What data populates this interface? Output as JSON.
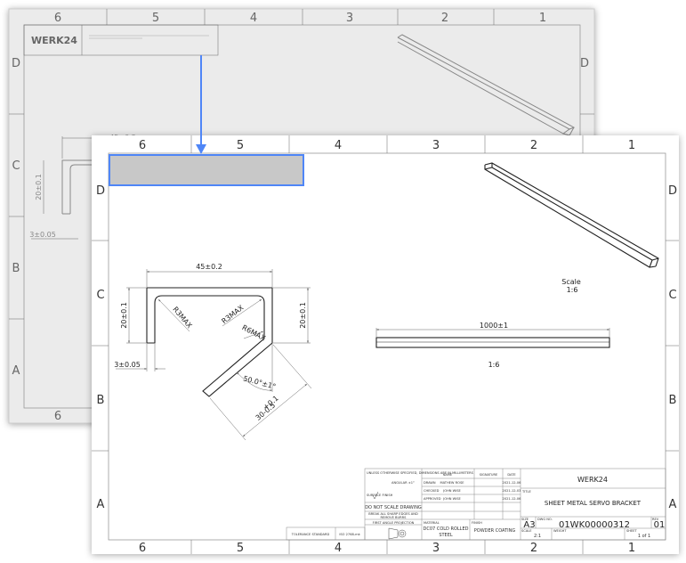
{
  "colors": {
    "accent": "#4f86f7",
    "highlight_fill": "#c8c8c8",
    "back_sheet": "#ebebeb"
  },
  "back_sheet": {
    "logo": "WERK24",
    "columns": [
      "6",
      "5",
      "4",
      "3",
      "2",
      "1"
    ],
    "rows": [
      "D",
      "C",
      "B",
      "A"
    ],
    "dims": {
      "width": "45±0.2",
      "height": "20±0.1",
      "thickness": "3±0.05"
    }
  },
  "sheet": {
    "columns": [
      "6",
      "5",
      "4",
      "3",
      "2",
      "1"
    ],
    "rows": [
      "D",
      "C",
      "B",
      "A"
    ],
    "front_view": {
      "width": "45±0.2",
      "height_left": "20±0.1",
      "height_right": "20±0.1",
      "thickness": "3±0.05",
      "radius1": "R3MAX",
      "radius2": "R3MAX",
      "radius3": "R6MAX",
      "angle": "50.0°±1°",
      "flange_tol": "+0.1",
      "flange_len": "30-0.5"
    },
    "iso_view": {
      "scale_label": "Scale",
      "scale_value": "1:6"
    },
    "side_view": {
      "length": "1000±1",
      "scale": "1:6"
    }
  },
  "title_block": {
    "general_tol": "UNLESS OTHERWISE SPECIFIED, DIMENSIONS ARE IN MILLIMETERS",
    "general_tol_2": "ANGULAR ±1°",
    "surface_finish": "SURFACE FINISH",
    "no_scale": "DO NOT SCALE DRAWING",
    "break_edges": "BREAK ALL SHARP EDGES AND",
    "break_edges_2": "REMOVE BURRS",
    "projection": "FIRST ANGLE PROJECTION",
    "headers": {
      "name": "NAME",
      "signature": "SIGNATURE",
      "date": "DATE"
    },
    "approvals": [
      {
        "role": "DRAWN",
        "name": "MATHEW ROSE",
        "date": "2021-12-06"
      },
      {
        "role": "CHECKED",
        "name": "JOHN WISE",
        "date": "2021-12-03"
      },
      {
        "role": "APPROVED",
        "name": "JOHN WISE",
        "date": "2021-12-06"
      }
    ],
    "material_label": "MATERIAL",
    "material": "DC07 COLD ROLLED",
    "material_2": "STEEL",
    "finish_label": "FINISH",
    "finish": "POWDER COATING",
    "company": "WERK24",
    "title_label": "TITLE",
    "title": "SHEET METAL SERVO BRACKET",
    "size_label": "SIZE",
    "size": "A3",
    "dwg_label": "DWG NO.",
    "dwg_no": "01WK00000312",
    "rev_label": "REV",
    "rev": "01",
    "scale_label": "SCALE",
    "scale": "2:1",
    "weight_label": "WEIGHT",
    "sheet_label": "SHEET",
    "sheet": "1 of 1",
    "tolerance_label": "TOLERANCE STANDARD",
    "tolerance": "ISO 2768-mk"
  }
}
